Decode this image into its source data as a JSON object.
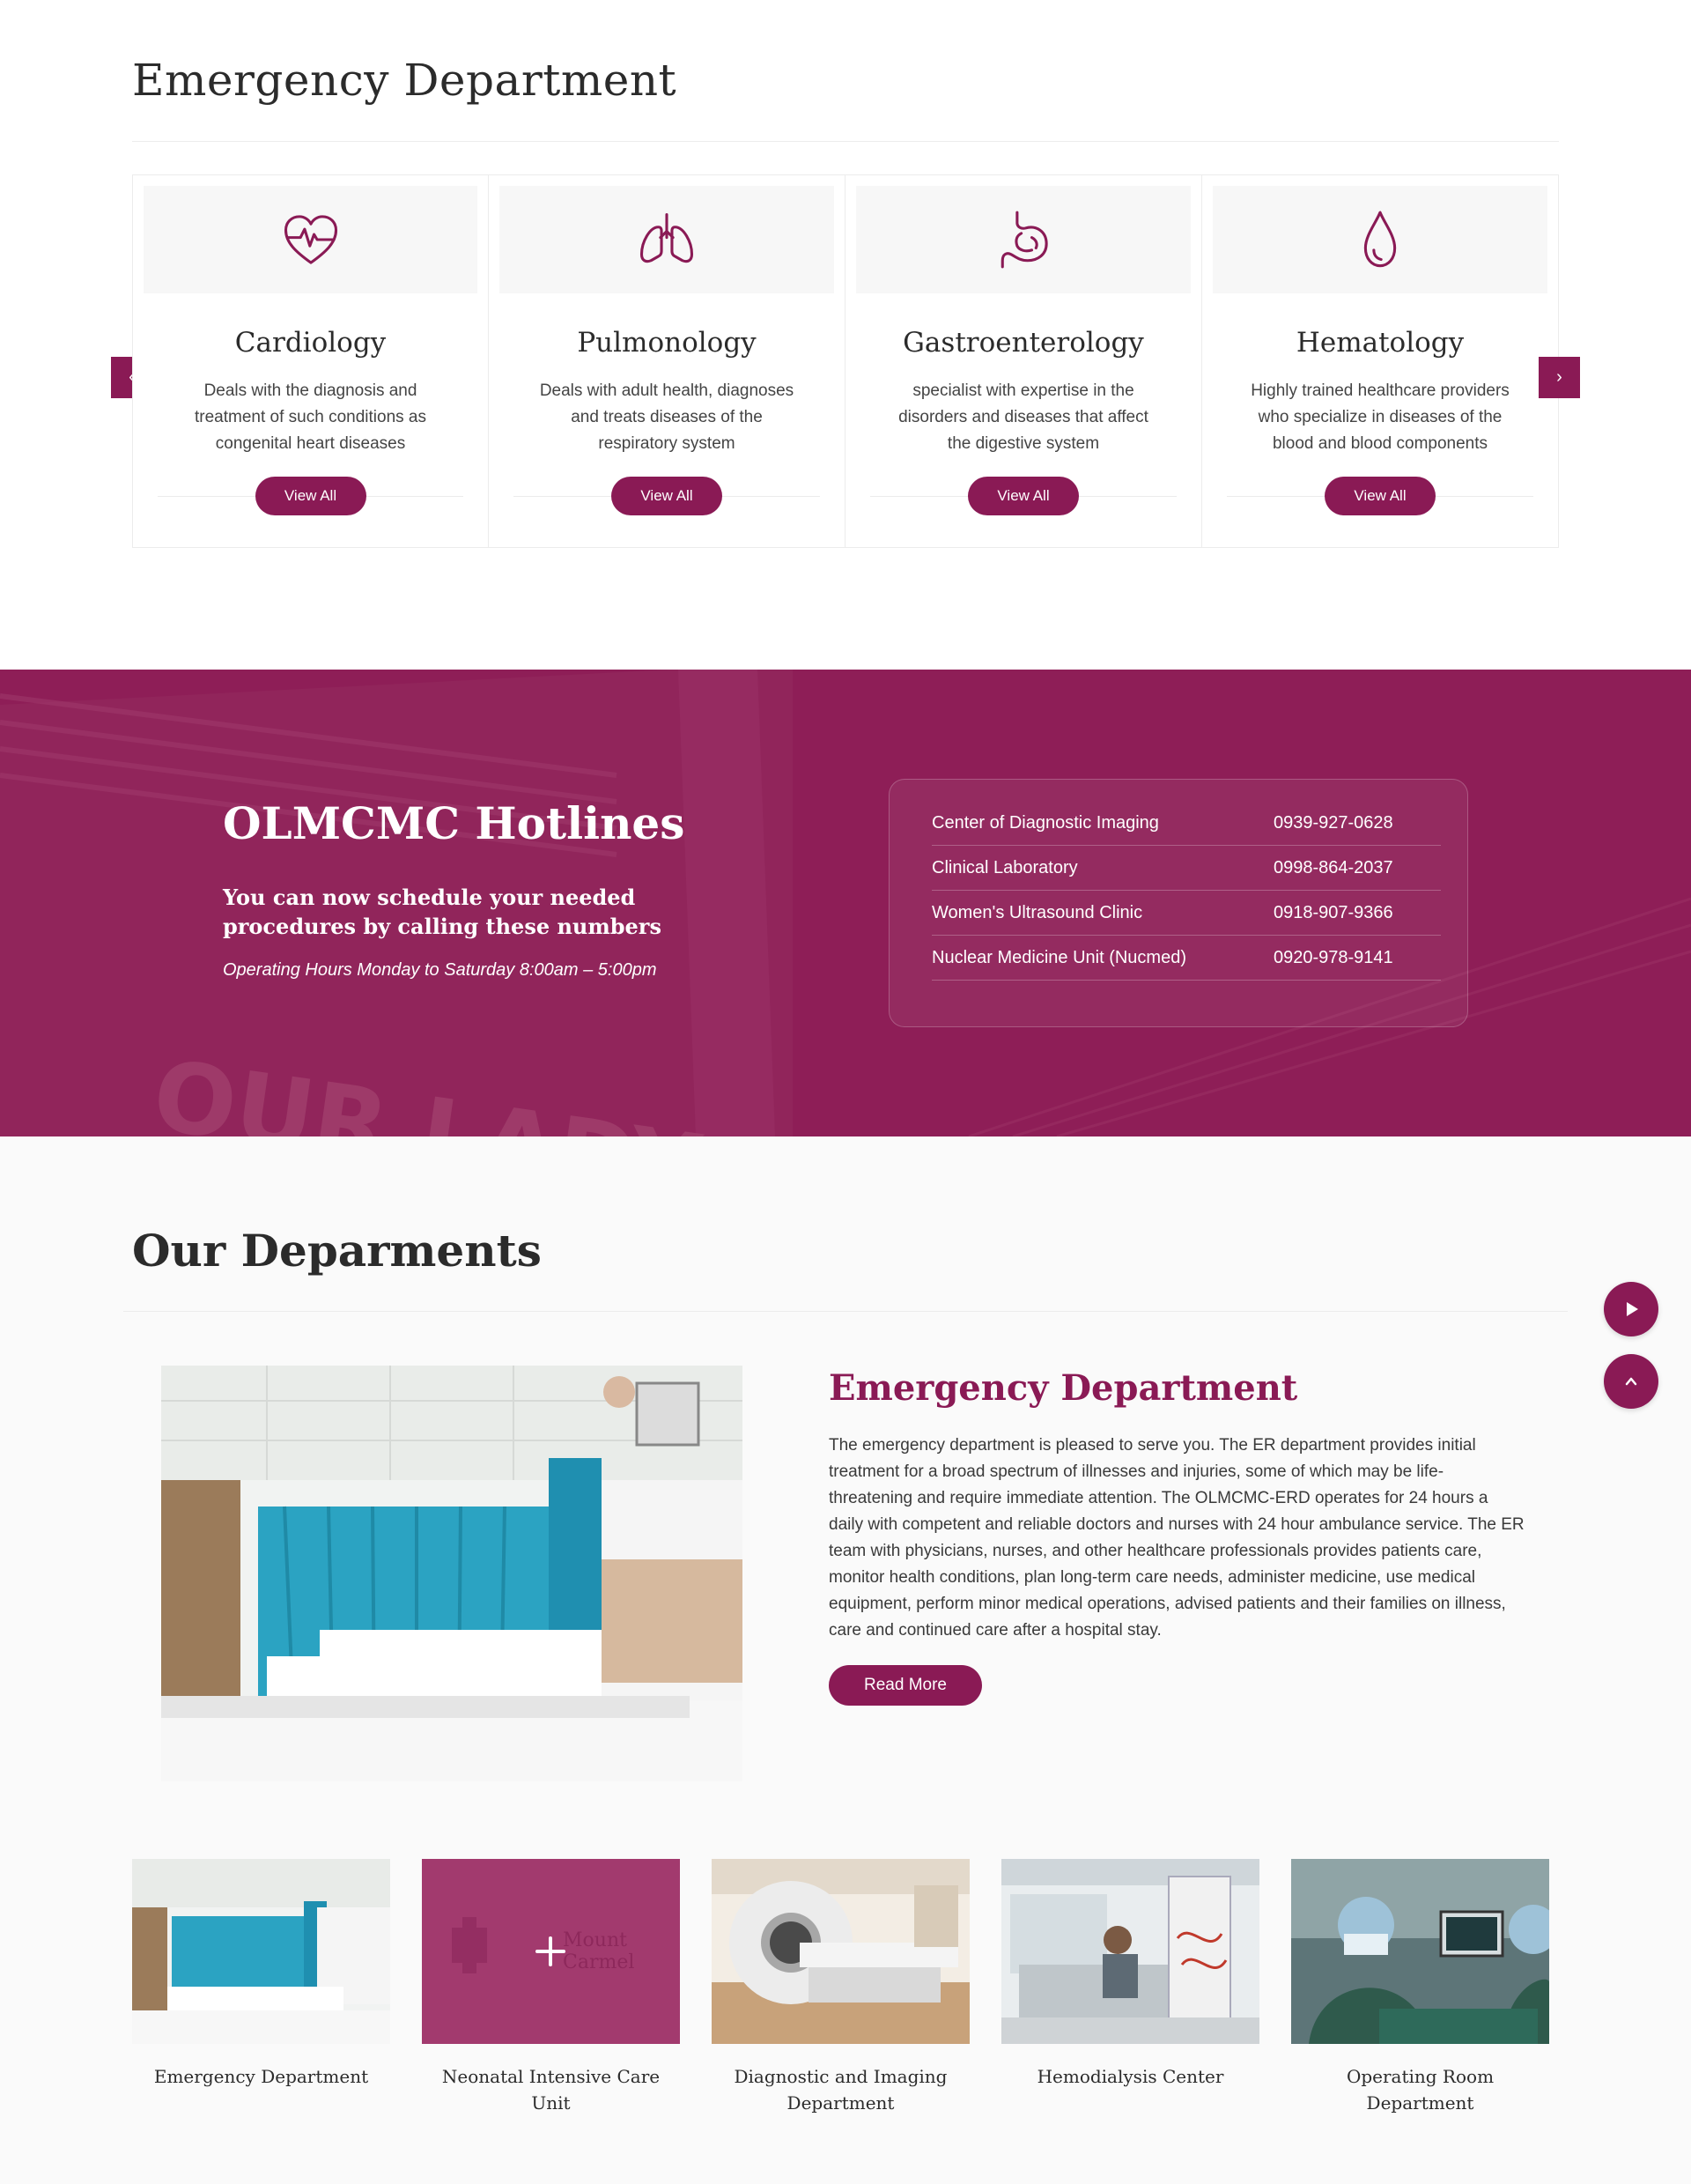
{
  "emergency_section": {
    "title": "Emergency Department",
    "prev_arrow": "‹",
    "next_arrow": "›",
    "cards": [
      {
        "title": "Cardiology",
        "description": "Deals with the diagnosis and treatment of such conditions as congenital heart diseases",
        "button": "View All",
        "icon": "heart-pulse-icon"
      },
      {
        "title": "Pulmonology",
        "description": "Deals with adult health, diagnoses and treats diseases of the respiratory system",
        "button": "View All",
        "icon": "lungs-icon"
      },
      {
        "title": "Gastroenterology",
        "description": "specialist with expertise in the disorders and diseases that affect the digestive system",
        "button": "View All",
        "icon": "stomach-icon"
      },
      {
        "title": "Hematology",
        "description": "Highly trained healthcare providers who specialize in diseases of the blood and blood components",
        "button": "View All",
        "icon": "blood-drop-icon"
      }
    ]
  },
  "hotlines": {
    "title": "OLMCMC Hotlines",
    "subtitle": "You can now schedule your needed procedures by calling these numbers",
    "hours": "Operating Hours Monday to Saturday 8:00am – 5:00pm",
    "rows": [
      {
        "name": "Center of Diagnostic Imaging",
        "number": "0939-927-0628"
      },
      {
        "name": "Clinical Laboratory",
        "number": "0998-864-2037"
      },
      {
        "name": "Women's Ultrasound Clinic",
        "number": "0918-907-9366"
      },
      {
        "name": "Nuclear Medicine Unit (Nucmed)",
        "number": "0920-978-9141"
      }
    ]
  },
  "departments": {
    "title": "Our Deparments",
    "featured": {
      "title": "Emergency Department",
      "text": "The emergency department is pleased to serve you. The ER department provides initial treatment for a broad spectrum of illnesses and injuries, some of which may be life-threatening and require immediate attention. The OLMCMC-ERD operates for 24 hours a daily with competent and reliable doctors and nurses with 24 hour ambulance service. The ER team with physicians, nurses, and other healthcare professionals provides patients care, monitor health conditions, plan long-term care needs, administer medicine, use medical equipment, perform minor medical operations, advised patients and their families on illness, care and continued care after a hospital stay.",
      "button": "Read More"
    },
    "thumbnails": [
      {
        "label": "Emergency Department"
      },
      {
        "label": "Neonatal Intensive Care Unit"
      },
      {
        "label": "Diagnostic and Imaging Department"
      },
      {
        "label": "Hemodialysis Center"
      },
      {
        "label": "Operating Room Department"
      }
    ],
    "nicu_overlay_text": "Mount Carmel"
  },
  "colors": {
    "brand": "#8a1a55",
    "hotline_bg": "#8e1e57"
  },
  "icons": {
    "play": "play-icon",
    "scroll_up": "chevron-up-icon"
  }
}
